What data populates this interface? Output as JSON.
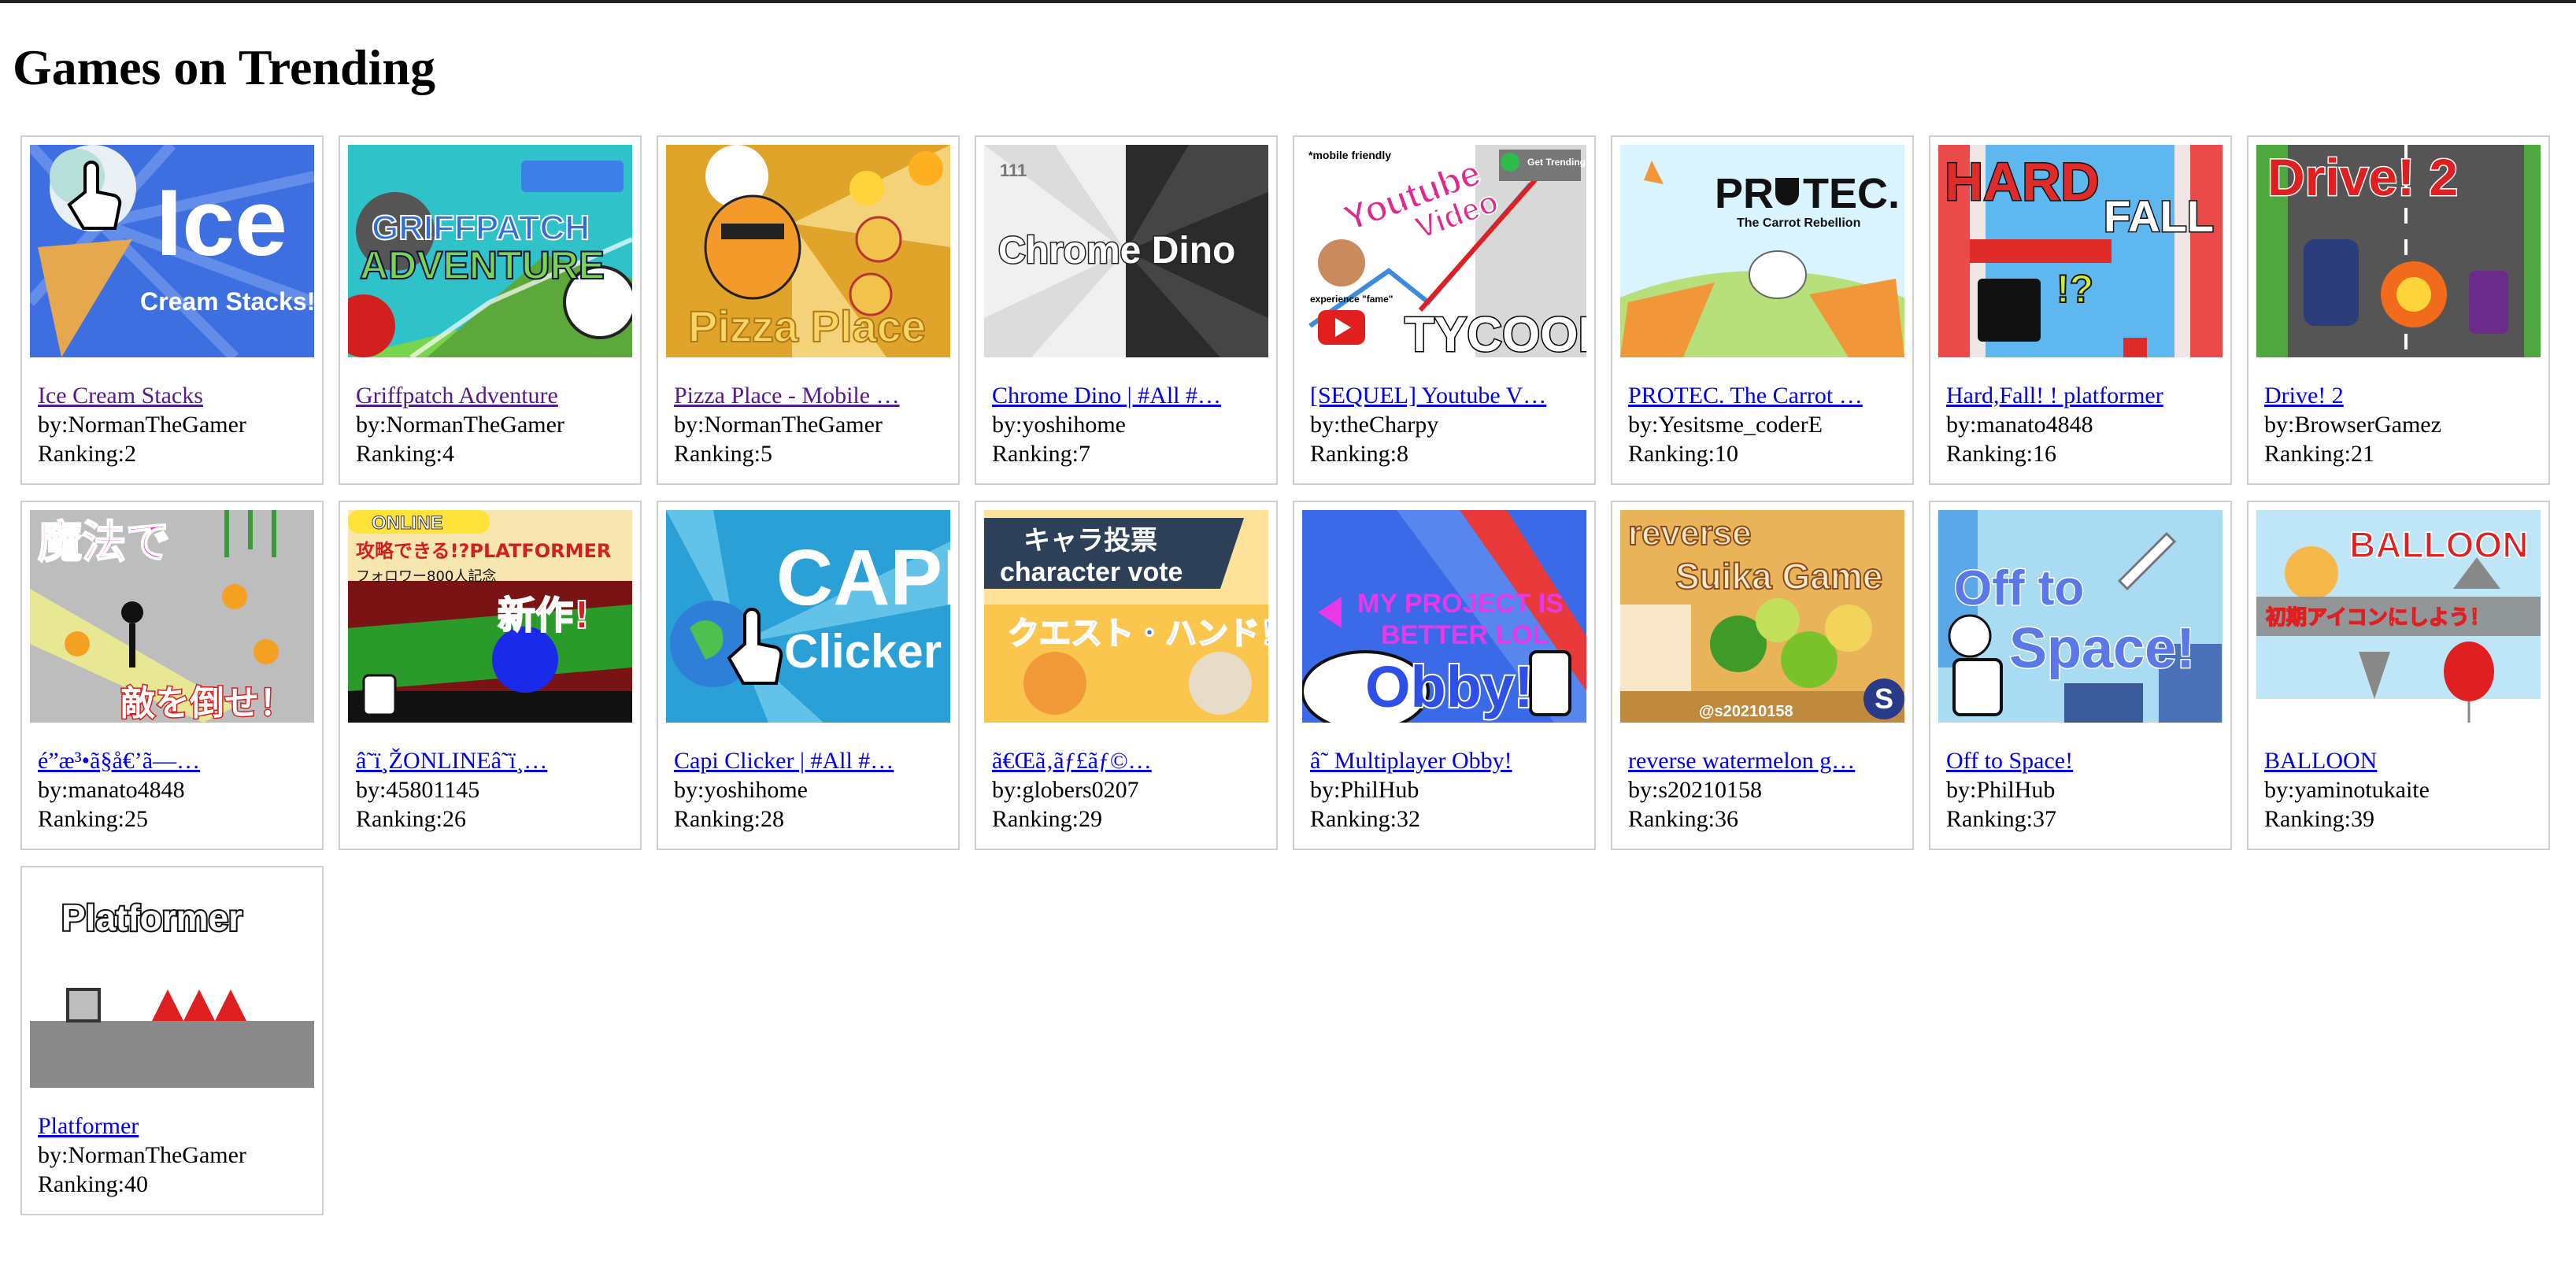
{
  "page": {
    "heading": "Games on Trending"
  },
  "games": [
    {
      "title": "Ice Cream Stacks",
      "author": "by:NormanTheGamer",
      "ranking": "Ranking:2",
      "visited": true,
      "thumb_text": [
        "Ice",
        "Cream Stacks!"
      ]
    },
    {
      "title": "Griffpatch Adventure",
      "author": "by:NormanTheGamer",
      "ranking": "Ranking:4",
      "visited": true,
      "thumb_text": [
        "GRIFFPATCH",
        "ADVENTURE"
      ]
    },
    {
      "title": "Pizza Place - Mobile …",
      "author": "by:NormanTheGamer",
      "ranking": "Ranking:5",
      "visited": true,
      "thumb_text": [
        "Pizza Place"
      ]
    },
    {
      "title": "Chrome Dino | #All #…",
      "author": "by:yoshihome",
      "ranking": "Ranking:7",
      "visited": false,
      "thumb_text": [
        "Chrome Dino",
        "111"
      ]
    },
    {
      "title": "[SEQUEL] Youtube V…",
      "author": "by:theCharpy",
      "ranking": "Ranking:8",
      "visited": false,
      "thumb_text": [
        "*mobile friendly",
        "Youtube",
        "Video",
        "TYCOON",
        "experience \"fame\"",
        "Get Trending"
      ]
    },
    {
      "title": "PROTEC. The Carrot …",
      "author": "by:Yesitsme_coderE",
      "ranking": "Ranking:10",
      "visited": false,
      "thumb_text": [
        "PR",
        "TEC.",
        "The Carrot Rebellion"
      ]
    },
    {
      "title": "Hard,Fall! ! platformer",
      "author": "by:manato4848",
      "ranking": "Ranking:16",
      "visited": false,
      "thumb_text": [
        "HARD",
        "FALL",
        "!?"
      ]
    },
    {
      "title": "Drive! 2",
      "author": "by:BrowserGamez",
      "ranking": "Ranking:21",
      "visited": false,
      "thumb_text": [
        "Drive! 2"
      ]
    },
    {
      "title": "é”æ³•ã§å€’ã—…",
      "author": "by:manato4848",
      "ranking": "Ranking:25",
      "visited": false,
      "thumb_text": [
        "魔法で",
        "敵を倒せ！"
      ]
    },
    {
      "title": "â˜ï¸ŽONLINEâ˜ï¸…",
      "author": "by:45801145",
      "ranking": "Ranking:26",
      "visited": false,
      "thumb_text": [
        "ONLINE",
        "攻略できる!?PLATFORMER",
        "フォロワー800人記念",
        "新作!"
      ]
    },
    {
      "title": "Capi Clicker | #All #…",
      "author": "by:yoshihome",
      "ranking": "Ranking:28",
      "visited": false,
      "thumb_text": [
        "CAPI",
        "Clicker"
      ]
    },
    {
      "title": "ã€Œã‚­ãƒ£ãƒ©…",
      "author": "by:globers0207",
      "ranking": "Ranking:29",
      "visited": false,
      "thumb_text": [
        "キャラ投票",
        "character vote",
        "クエスト・ハンド！"
      ]
    },
    {
      "title": "â˜ Multiplayer Obby!",
      "author": "by:PhilHub",
      "ranking": "Ranking:32",
      "visited": false,
      "thumb_text": [
        "MY PROJECT IS",
        "BETTER LOL",
        "Obby!"
      ]
    },
    {
      "title": "reverse watermelon g…",
      "author": "by:s20210158",
      "ranking": "Ranking:36",
      "visited": false,
      "thumb_text": [
        "reverse",
        "Suika Game",
        "@s20210158",
        "S"
      ]
    },
    {
      "title": "Off to Space!",
      "author": "by:PhilHub",
      "ranking": "Ranking:37",
      "visited": false,
      "thumb_text": [
        "Off to",
        "Space!"
      ]
    },
    {
      "title": "BALLOON",
      "author": "by:yaminotukaite",
      "ranking": "Ranking:39",
      "visited": false,
      "thumb_text": [
        "BALLOON",
        "初期アイコンにしよう！"
      ]
    },
    {
      "title": "Platformer",
      "author": "by:NormanTheGamer",
      "ranking": "Ranking:40",
      "visited": false,
      "thumb_text": [
        "Platformer"
      ]
    }
  ],
  "colors": {
    "link": "#0000ee",
    "visited_link": "#551a8b",
    "card_border": "#d0d0d0",
    "top_bar": "#202124"
  }
}
